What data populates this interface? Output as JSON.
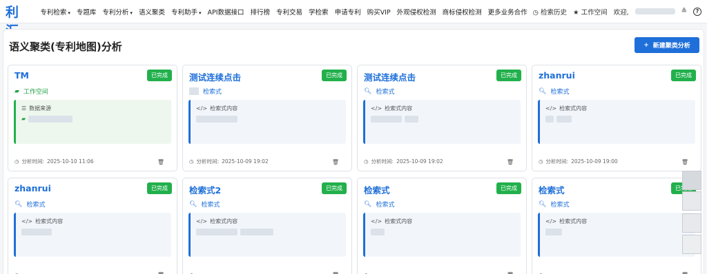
{
  "nav": {
    "logo": "专利汇",
    "items": [
      {
        "label": "专利检索",
        "caret": true,
        "blue": false
      },
      {
        "label": "专题库",
        "caret": false,
        "blue": false
      },
      {
        "label": "专利分析",
        "caret": true,
        "blue": false
      },
      {
        "label": "语义聚类",
        "caret": false,
        "blue": false
      },
      {
        "label": "专利助手",
        "caret": true,
        "blue": false
      },
      {
        "label": "API数据接口",
        "caret": false,
        "blue": true
      },
      {
        "label": "排行榜",
        "caret": false,
        "blue": false
      },
      {
        "label": "专利交易",
        "caret": false,
        "blue": true
      },
      {
        "label": "学检索",
        "caret": false,
        "blue": false
      },
      {
        "label": "申请专利",
        "caret": false,
        "blue": false
      },
      {
        "label": "购买VIP",
        "caret": false,
        "blue": true
      },
      {
        "label": "外观侵权检测",
        "caret": false,
        "blue": false
      },
      {
        "label": "商标侵权检测",
        "caret": false,
        "blue": false
      },
      {
        "label": "更多业务合作",
        "caret": false,
        "blue": false
      }
    ],
    "history": "检索历史",
    "workspace": "工作空间",
    "welcome": "欢迎,",
    "help": "?"
  },
  "page": {
    "title": "语义聚类(专利地图)分析",
    "new_button": "新建聚类分析"
  },
  "cards": [
    {
      "title": "TM",
      "status": "已完成",
      "sub": "工作空间",
      "sub_type": "workspace",
      "box_label": "数据来源",
      "box_type": "source",
      "time_label": "分析时间:",
      "time": "2025-10-10 11:06"
    },
    {
      "title": "测试连续点击",
      "status": "已完成",
      "sub": "检索式",
      "sub_type": "query-blank",
      "box_label": "检索式内容",
      "box_type": "query",
      "time_label": "分析时间:",
      "time": "2025-10-09 19:02"
    },
    {
      "title": "测试连续点击",
      "status": "已完成",
      "sub": "检索式",
      "sub_type": "query",
      "box_label": "检索式内容",
      "box_type": "query",
      "time_label": "分析时间:",
      "time": "2025-10-09 19:02"
    },
    {
      "title": "zhanrui",
      "status": "已完成",
      "sub": "检索式",
      "sub_type": "query",
      "box_label": "检索式内容",
      "box_type": "query",
      "time_label": "分析时间:",
      "time": "2025-10-09 19:00"
    },
    {
      "title": "zhanrui",
      "status": "已完成",
      "sub": "检索式",
      "sub_type": "query",
      "box_label": "检索式内容",
      "box_type": "query",
      "time_label": "",
      "time": ""
    },
    {
      "title": "检索式2",
      "status": "已完成",
      "sub": "检索式",
      "sub_type": "query",
      "box_label": "检索式内容",
      "box_type": "query",
      "time_label": "",
      "time": ""
    },
    {
      "title": "检索式",
      "status": "已完成",
      "sub": "检索式",
      "sub_type": "query",
      "box_label": "检索式内容",
      "box_type": "query",
      "time_label": "",
      "time": ""
    },
    {
      "title": "检索式",
      "status": "已完成",
      "sub": "检索式",
      "sub_type": "query",
      "box_label": "检索式内容",
      "box_type": "query",
      "time_label": "",
      "time": ""
    }
  ],
  "colors": {
    "brand": "#1e6fd9",
    "success": "#22b04c"
  }
}
